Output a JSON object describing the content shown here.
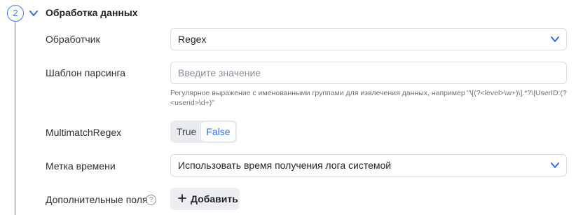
{
  "step": {
    "number": "2",
    "title": "Обработка данных"
  },
  "fields": {
    "handler": {
      "label": "Обработчик",
      "value": "Regex"
    },
    "pattern": {
      "label": "Шаблон парсинга",
      "placeholder": "Введите значение",
      "value": "",
      "hint": "Регулярное выражение с именованными группами для извлечения данных, например \"\\[(?<level>\\w+)\\].*?\\|UserID:(?<userid>\\d+)\""
    },
    "multimatch": {
      "label": "MultimatchRegex",
      "options": [
        "True",
        "False"
      ],
      "selected": "False"
    },
    "timestamp": {
      "label": "Метка времени",
      "value": "Использовать время получения лога системой"
    },
    "extra_fields": {
      "label": "Дополнительные поля",
      "help_icon": "question-circle-icon",
      "add_label": "Добавить"
    }
  },
  "colors": {
    "accent": "#3d7bf0",
    "border": "#d9dde3",
    "toggle_bg": "#e9ebee",
    "button_bg": "#eceef1"
  }
}
